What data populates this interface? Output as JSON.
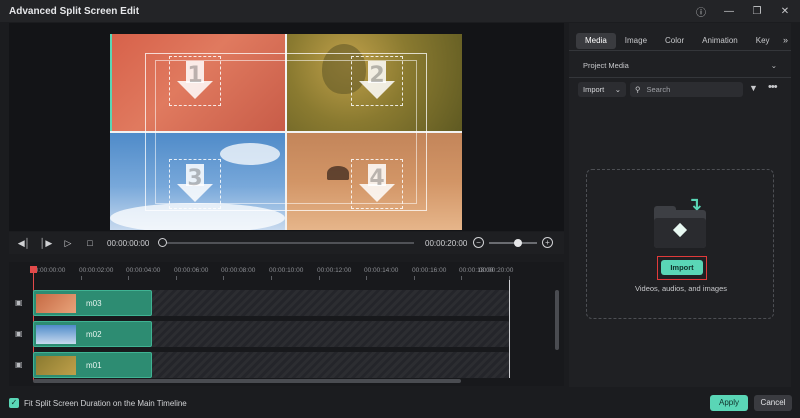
{
  "window": {
    "title": "Advanced Split Screen Edit",
    "controls": [
      "help-icon",
      "minimize-icon",
      "restore-icon",
      "close-icon"
    ]
  },
  "preview": {
    "cells": [
      "1",
      "2",
      "3",
      "4"
    ]
  },
  "playback": {
    "current_time": "00:00:00:00",
    "end_time": "00:00:20:00",
    "progress": 0
  },
  "timeline": {
    "ruler_ticks": [
      "00:00:00:00",
      "00:00:02:00",
      "00:00:04:00",
      "00:00:06:00",
      "00:00:08:00",
      "00:00:10:00",
      "00:00:12:00",
      "00:00:14:00",
      "00:00:16:00",
      "00:00:18:00",
      "00:00:20:00"
    ],
    "tracks": [
      {
        "clip": "m03"
      },
      {
        "clip": "m02"
      },
      {
        "clip": "m01"
      }
    ]
  },
  "panel": {
    "tabs": [
      "Media",
      "Image",
      "Color",
      "Animation",
      "Key"
    ],
    "active_tab": "Media",
    "source_select": "Project Media",
    "import_dropdown": "Import",
    "search_placeholder": "Search",
    "import_button": "Import",
    "drop_caption": "Videos, audios, and images"
  },
  "footer": {
    "fit_label": "Fit Split Screen Duration on the Main Timeline",
    "fit_checked": true,
    "apply": "Apply",
    "cancel": "Cancel"
  },
  "colors": {
    "accent": "#5ad6b6",
    "clip": "#2d8c72",
    "playhead": "#e24a4a",
    "highlight": "#e03a3a"
  }
}
